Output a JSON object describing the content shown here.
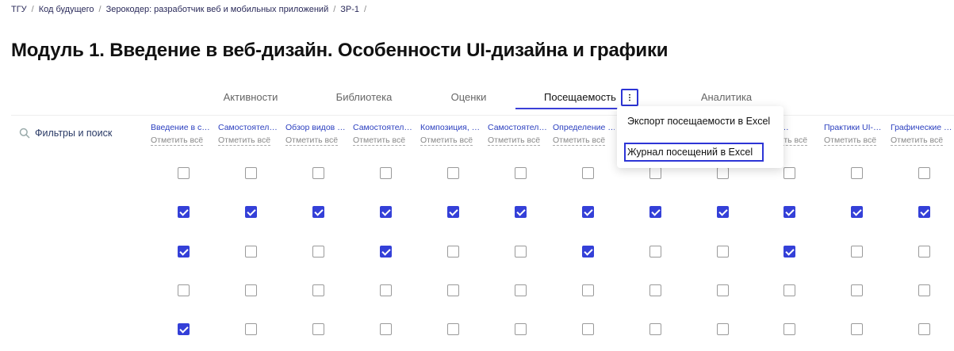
{
  "breadcrumb": [
    "ТГУ",
    "Код будущего",
    "Зерокодер: разработчик веб и мобильных приложений",
    "ЗР-1"
  ],
  "page_title": "Модуль 1. Введение в веб-дизайн. Особенности UI-дизайна и графики",
  "tabs": [
    "Активности",
    "Библиотека",
    "Оценки",
    "Посещаемость",
    "Аналитика"
  ],
  "active_tab": "Посещаемость",
  "filter_label": "Фильтры и поиск",
  "mark_all_label": "Отметить всё",
  "columns": [
    "Введение в с…",
    "Самостоятел…",
    "Обзор видов …",
    "Самостоятел…",
    "Композиция, …",
    "Самостоятел…",
    "Определение …",
    "",
    "",
    "е набо…",
    "Практики UI-…",
    "Графические …"
  ],
  "dropdown": {
    "items": [
      "Экспорт посещаемости в Excel",
      "Журнал посещений в Excel"
    ]
  },
  "attendance": [
    [
      0,
      0,
      0,
      0,
      0,
      0,
      0,
      0,
      0,
      0,
      0,
      0
    ],
    [
      1,
      1,
      1,
      1,
      1,
      1,
      1,
      1,
      1,
      1,
      1,
      1
    ],
    [
      1,
      0,
      0,
      1,
      0,
      0,
      1,
      0,
      0,
      1,
      0,
      0
    ],
    [
      0,
      0,
      0,
      0,
      0,
      0,
      0,
      0,
      0,
      0,
      0,
      0
    ],
    [
      1,
      0,
      0,
      0,
      0,
      0,
      0,
      0,
      0,
      0,
      0,
      0
    ]
  ],
  "colors": {
    "accent": "#3440d8",
    "link": "#2b3fbf",
    "highlight_border": "#2d35d6"
  }
}
